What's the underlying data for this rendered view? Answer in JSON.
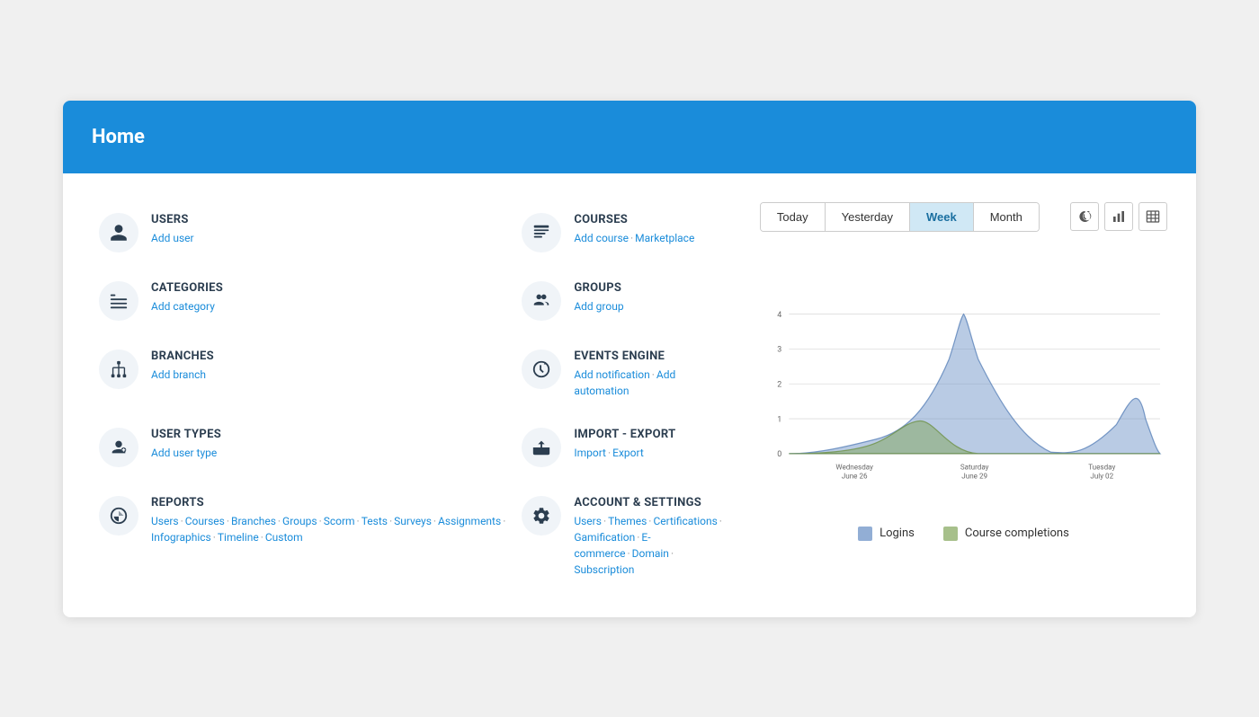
{
  "header": {
    "title": "Home"
  },
  "menu": {
    "items": [
      {
        "id": "users",
        "title": "USERS",
        "links": [
          {
            "label": "Add user",
            "href": "#"
          }
        ],
        "icon": "user-icon"
      },
      {
        "id": "courses",
        "title": "COURSES",
        "links": [
          {
            "label": "Add course",
            "href": "#"
          },
          {
            "label": "Marketplace",
            "href": "#"
          }
        ],
        "icon": "courses-icon"
      },
      {
        "id": "categories",
        "title": "CATEGORIES",
        "links": [
          {
            "label": "Add category",
            "href": "#"
          }
        ],
        "icon": "categories-icon"
      },
      {
        "id": "groups",
        "title": "GROUPS",
        "links": [
          {
            "label": "Add group",
            "href": "#"
          }
        ],
        "icon": "groups-icon"
      },
      {
        "id": "branches",
        "title": "BRANCHES",
        "links": [
          {
            "label": "Add branch",
            "href": "#"
          }
        ],
        "icon": "branches-icon"
      },
      {
        "id": "events-engine",
        "title": "EVENTS ENGINE",
        "links": [
          {
            "label": "Add notification",
            "href": "#"
          },
          {
            "label": "Add automation",
            "href": "#"
          }
        ],
        "icon": "events-icon"
      },
      {
        "id": "user-types",
        "title": "USER TYPES",
        "links": [
          {
            "label": "Add user type",
            "href": "#"
          }
        ],
        "icon": "user-types-icon"
      },
      {
        "id": "import-export",
        "title": "IMPORT - EXPORT",
        "links": [
          {
            "label": "Import",
            "href": "#"
          },
          {
            "label": "Export",
            "href": "#"
          }
        ],
        "icon": "import-export-icon"
      },
      {
        "id": "reports",
        "title": "REPORTS",
        "links": [
          {
            "label": "Users",
            "href": "#"
          },
          {
            "label": "Courses",
            "href": "#"
          },
          {
            "label": "Branches",
            "href": "#"
          },
          {
            "label": "Groups",
            "href": "#"
          },
          {
            "label": "Scorm",
            "href": "#"
          },
          {
            "label": "Tests",
            "href": "#"
          },
          {
            "label": "Surveys",
            "href": "#"
          },
          {
            "label": "Assignments",
            "href": "#"
          },
          {
            "label": "Infographics",
            "href": "#"
          },
          {
            "label": "Timeline",
            "href": "#"
          },
          {
            "label": "Custom",
            "href": "#"
          }
        ],
        "icon": "reports-icon"
      },
      {
        "id": "account-settings",
        "title": "ACCOUNT & SETTINGS",
        "links": [
          {
            "label": "Users",
            "href": "#"
          },
          {
            "label": "Themes",
            "href": "#"
          },
          {
            "label": "Certifications",
            "href": "#"
          },
          {
            "label": "Gamification",
            "href": "#"
          },
          {
            "label": "E-commerce",
            "href": "#"
          },
          {
            "label": "Domain",
            "href": "#"
          },
          {
            "label": "Subscription",
            "href": "#"
          }
        ],
        "icon": "settings-icon"
      }
    ]
  },
  "chart": {
    "tabs": [
      "Today",
      "Yesterday",
      "Week",
      "Month"
    ],
    "active_tab": "Week",
    "x_labels": [
      "Wednesday\nJune 26",
      "Saturday\nJune 29",
      "Tuesday\nJuly 02"
    ],
    "y_labels": [
      "0",
      "1",
      "2",
      "3",
      "4"
    ],
    "legend": [
      {
        "label": "Logins",
        "color": "#8aabce"
      },
      {
        "label": "Course completions",
        "color": "#8aad6e"
      }
    ],
    "icons": [
      "history-icon",
      "chart-icon",
      "table-icon"
    ]
  }
}
